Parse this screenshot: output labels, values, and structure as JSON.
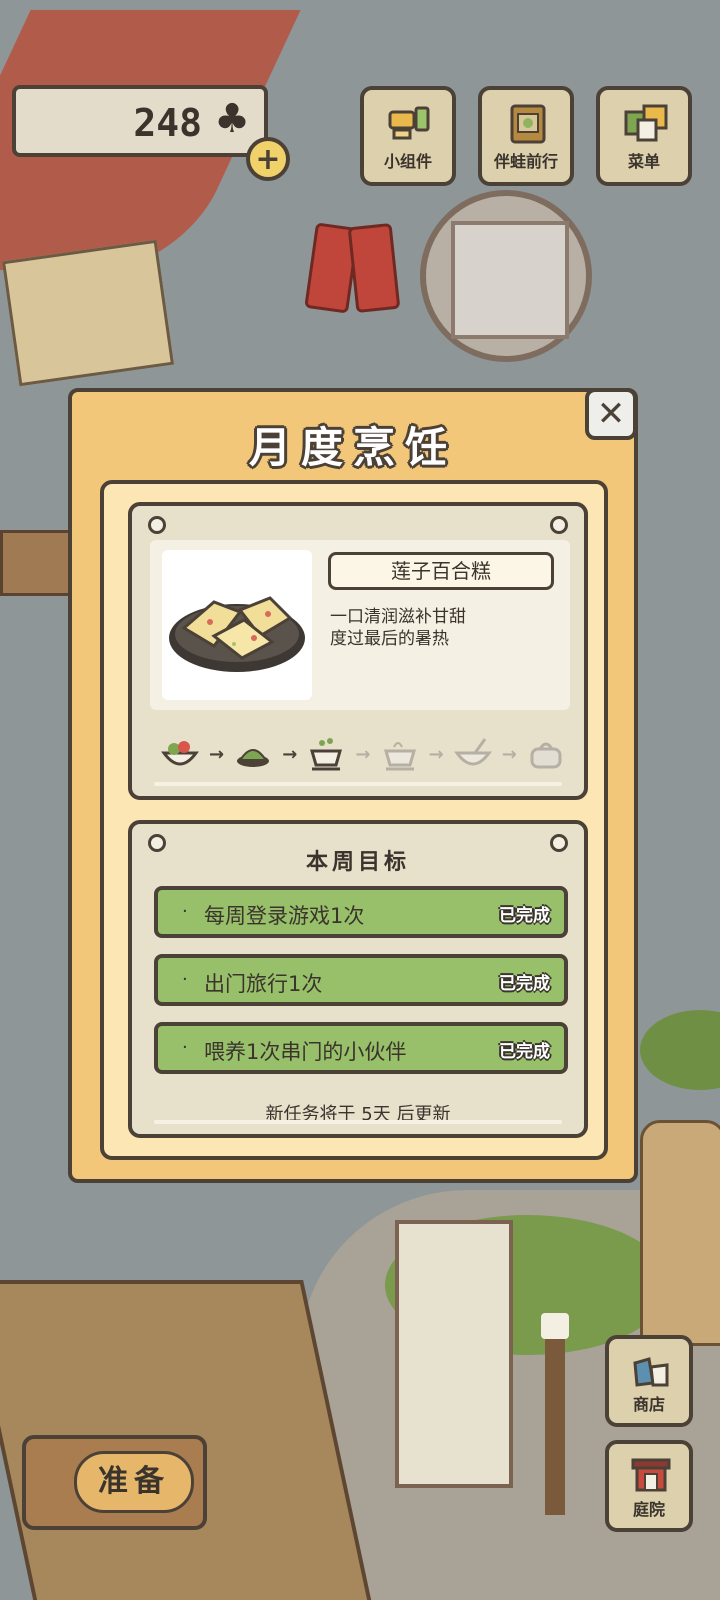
{
  "currency": {
    "clovers": "248",
    "icon": "clover-icon",
    "plus_label": "+"
  },
  "top_menu": [
    {
      "label": "小组件",
      "icon": "widget-icon"
    },
    {
      "label": "伴蛙前行",
      "icon": "travel-book-icon"
    },
    {
      "label": "菜单",
      "icon": "menu-icon"
    }
  ],
  "dialog": {
    "title": "月度烹饪",
    "close_label": "✕",
    "recipe": {
      "name": "莲子百合糕",
      "description_line1": "一口清润滋补甘甜",
      "description_line2": "度过最后的暑热",
      "steps": [
        {
          "icon": "ingredients-bowl-icon",
          "state": "done"
        },
        {
          "icon": "herbs-icon",
          "state": "done"
        },
        {
          "icon": "cooking-pot-icon",
          "state": "done"
        },
        {
          "icon": "steaming-pot-icon",
          "state": "locked"
        },
        {
          "icon": "bowl-spoon-icon",
          "state": "locked"
        },
        {
          "icon": "bag-icon",
          "state": "locked"
        }
      ]
    },
    "weekly": {
      "title": "本周目标",
      "goals": [
        {
          "text": "每周登录游戏1次",
          "status": "已完成"
        },
        {
          "text": "出门旅行1次",
          "status": "已完成"
        },
        {
          "text": "喂养1次串门的小伙伴",
          "status": "已完成"
        }
      ],
      "refresh_note": "新任务将于 5天 后更新"
    }
  },
  "bottom": {
    "prepare_label": "准备",
    "shop_label": "商店",
    "yard_label": "庭院"
  },
  "colors": {
    "outline": "#4b4137",
    "panel": "#f2c779",
    "goal_green": "#98c06a",
    "card": "#e7e1cc"
  }
}
